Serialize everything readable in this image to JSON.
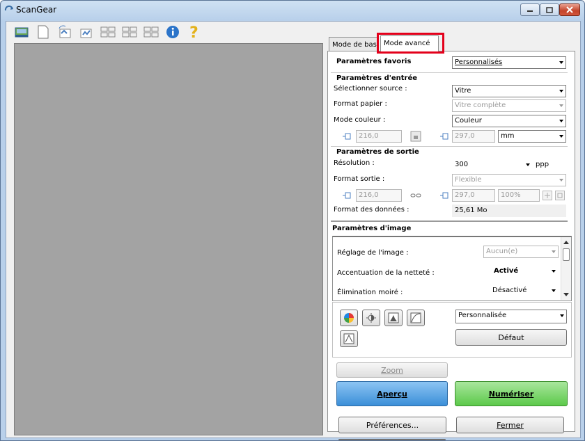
{
  "window": {
    "title": "ScanGear"
  },
  "icons": {
    "app": "scanner-icon",
    "toolbar": [
      "scan-thumbnail-icon",
      "blank-page-icon",
      "rotate-left-icon",
      "rotate-right-icon",
      "thumbnail-grid-icon",
      "multi-crop-icon",
      "crop-frame-icon",
      "info-icon",
      "help-icon"
    ]
  },
  "tabs": {
    "basic": "Mode de base",
    "advanced": "Mode avancé"
  },
  "favorites": {
    "label": "Paramètres favoris",
    "value": "Personnalisés"
  },
  "input": {
    "header": "Paramètres d'entrée",
    "source_label": "Sélectionner source :",
    "source_value": "Vitre",
    "paper_label": "Format papier :",
    "paper_value": "Vitre complète",
    "color_label": "Mode couleur :",
    "color_value": "Couleur",
    "width": "216,0",
    "height": "297,0",
    "unit": "mm"
  },
  "output": {
    "header": "Paramètres de sortie",
    "res_label": "Résolution :",
    "res_value": "300",
    "res_unit": "ppp",
    "size_label": "Format sortie :",
    "size_value": "Flexible",
    "width": "216,0",
    "height": "297,0",
    "scale": "100%",
    "data_label": "Format des données :",
    "data_value": "25,61 Mo"
  },
  "image": {
    "header": "Paramètres d'image",
    "rows": [
      {
        "label": "Réglage de l'image :",
        "value": "Aucun(e)"
      },
      {
        "label": "Accentuation de la netteté :",
        "value": "Activé"
      },
      {
        "label": "Élimination moiré :",
        "value": "Désactivé"
      }
    ]
  },
  "tone": {
    "preset": "Personnalisée",
    "default_btn": "Défaut"
  },
  "actions": {
    "zoom": "Zoom",
    "preview": "Aperçu",
    "scan": "Numériser",
    "prefs": "Préférences...",
    "close": "Fermer"
  },
  "colors": {
    "preview_bg": "#a3a3a3",
    "highlight": "#e3001b",
    "preview_btn": "#3b8fd8",
    "scan_btn": "#5cc94a"
  }
}
